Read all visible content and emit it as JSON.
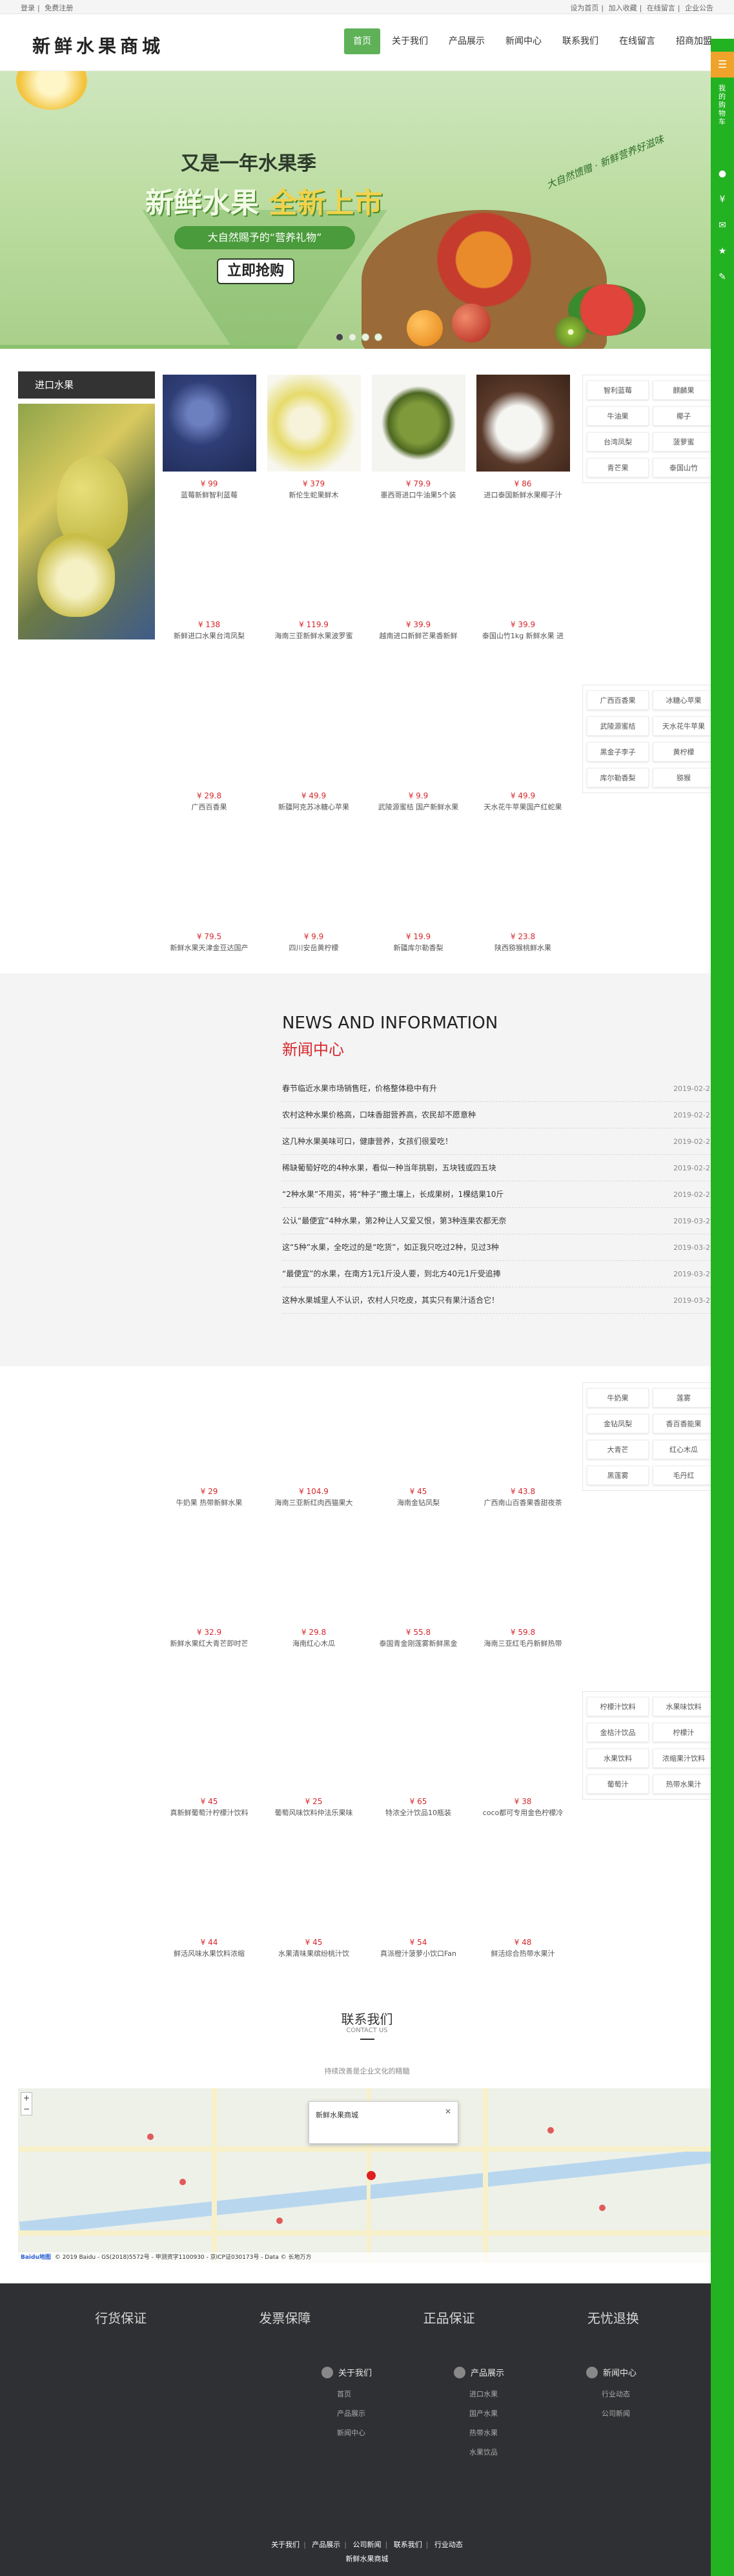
{
  "topbar": {
    "login": "登录",
    "register": "免费注册",
    "home": "设为首页",
    "favorite": "加入收藏",
    "message": "在线留言",
    "company": "企业公告"
  },
  "logo": "新鲜水果商城",
  "nav": [
    "首页",
    "关于我们",
    "产品展示",
    "新闻中心",
    "联系我们",
    "在线留言",
    "招商加盟"
  ],
  "banner": {
    "sub": "又是一年水果季",
    "title_a": "新鲜水果 ",
    "title_b": "全新上市",
    "ribbon": "大自然赐予的“营养礼物”",
    "button": "立即抢购",
    "brush": "大自然馈赠 · 新鲜营养好滋味"
  },
  "category": {
    "title": "进口水果"
  },
  "products": [
    {
      "price": "¥ 99",
      "name": "蓝莓新鲜智利蓝莓"
    },
    {
      "price": "¥ 379",
      "name": "新伦生蛇果鲜木"
    },
    {
      "price": "¥ 79.9",
      "name": "墨西哥进口牛油果5个装"
    },
    {
      "price": "¥ 86",
      "name": "进口泰国新鲜水果椰子汁"
    },
    {
      "price": "¥ 138",
      "name": "新鲜进口水果台湾凤梨"
    },
    {
      "price": "¥ 119.9",
      "name": "海南三亚新鲜水果波罗蜜"
    },
    {
      "price": "¥ 39.9",
      "name": "越南进口新鲜芒果香新鲜"
    },
    {
      "price": "¥ 39.9",
      "name": "泰国山竹1kg 新鲜水果 进"
    }
  ],
  "tags1": [
    "智利蓝莓",
    "麒麟果",
    "牛油果",
    "椰子",
    "台湾凤梨",
    "菠萝蜜",
    "青芒果",
    "泰国山竹"
  ],
  "products2": [
    {
      "price": "¥ 29.8",
      "name": "广西百香果"
    },
    {
      "price": "¥ 49.9",
      "name": "新疆阿克苏冰糖心苹果"
    },
    {
      "price": "¥ 9.9",
      "name": "武陵源蜜桔 国产新鲜水果"
    },
    {
      "price": "¥ 49.9",
      "name": "天水花牛苹果国产红蛇果"
    },
    {
      "price": "¥ 79.5",
      "name": "新鲜水果天津金豆达国产"
    },
    {
      "price": "¥ 9.9",
      "name": "四川安岳黄柠檬"
    },
    {
      "price": "¥ 19.9",
      "name": "新疆库尔勒香梨"
    },
    {
      "price": "¥ 23.8",
      "name": "陕西猕猴桃鲜水果"
    }
  ],
  "tags2": [
    "广西百香果",
    "冰糖心苹果",
    "武陵源蜜桔",
    "天水花牛苹果",
    "黑金子李子",
    "黄柠檬",
    "库尔勒香梨",
    "猕猴"
  ],
  "news": {
    "en": "NEWS AND INFORMATION",
    "cn": "新闻中心",
    "items": [
      {
        "t": "春节临近水果市场销售旺，价格整体稳中有升",
        "d": "2019-02-25"
      },
      {
        "t": "农村这种水果价格高，口味香甜营养高，农民却不愿意种",
        "d": "2019-02-25"
      },
      {
        "t": "这几种水果美味可口，健康营养，女孩们很爱吃！",
        "d": "2019-02-25"
      },
      {
        "t": "稀缺葡萄好吃的4种水果，看似一种当年挑剔，五块钱或四五块",
        "d": "2019-02-25"
      },
      {
        "t": "“2种水果”不用买，将“种子”撒土壤上，长成果树，1棵结果10斤",
        "d": "2019-02-25"
      },
      {
        "t": "公认“最便宜”4种水果，第2种让人又爱又恨，第3种连果农都无奈",
        "d": "2019-03-29"
      },
      {
        "t": "这“5种”水果，全吃过的是“吃货”，如正我只吃过2种，见过3种",
        "d": "2019-03-29"
      },
      {
        "t": "“最便宜”的水果，在南方1元1斤没人要，到北方40元1斤受追捧",
        "d": "2019-03-29"
      },
      {
        "t": "这种水果城里人不认识，农村人只吃皮，其实只有果汁适合它！",
        "d": "2019-03-29"
      }
    ]
  },
  "products3": [
    {
      "price": "¥ 29",
      "name": "牛奶果 热带新鲜水果"
    },
    {
      "price": "¥ 104.9",
      "name": "海南三亚新红肉西猫果大"
    },
    {
      "price": "¥ 45",
      "name": "海南金钻凤梨"
    },
    {
      "price": "¥ 43.8",
      "name": "广西南山百香果香甜夜茶"
    },
    {
      "price": "¥ 32.9",
      "name": "新鲜水果红大青芒即时芒"
    },
    {
      "price": "¥ 29.8",
      "name": "海南红心木瓜"
    },
    {
      "price": "¥ 55.8",
      "name": "泰国青金刚莲雾新鲜黑金"
    },
    {
      "price": "¥ 59.8",
      "name": "海南三亚红毛丹新鲜热带"
    }
  ],
  "tags3": [
    "牛奶果",
    "莲雾",
    "金钻凤梨",
    "香百香能果",
    "大青芒",
    "红心木瓜",
    "黑莲雾",
    "毛丹红"
  ],
  "products4": [
    {
      "price": "¥ 45",
      "name": "真新鲜葡萄汁柠檬汁饮料"
    },
    {
      "price": "¥ 25",
      "name": "葡萄风味饮料仲法乐果味"
    },
    {
      "price": "¥ 65",
      "name": "特浓全汁饮品10瓶装"
    },
    {
      "price": "¥ 38",
      "name": "coco都可专用金色柠檬冷"
    },
    {
      "price": "¥ 44",
      "name": "鲜活风味水果饮料浓缩"
    },
    {
      "price": "¥ 45",
      "name": "水果清味果缤纷桃汁饮"
    },
    {
      "price": "¥ 54",
      "name": "真派橙汁菠萝小饮口Fan"
    },
    {
      "price": "¥ 48",
      "name": "鲜活综合热带水果汁"
    }
  ],
  "tags4": [
    "柠檬汁饮料",
    "水果味饮料",
    "金桔汁饮品",
    "柠檬汁",
    "水果饮料",
    "浓缩果汁饮料",
    "葡萄汁",
    "热带水果汁"
  ],
  "contact": {
    "title": "联系我们",
    "sub": "CONTACT US",
    "desc": "持续改善是企业文化的精髓",
    "bubble": "新鲜水果商城",
    "copyright": "© 2019 Baidu - GS(2018)5572号 - 甲测资字1100930 - 京ICP证030173号 - Data © 长地万方",
    "baidu": "Baidu地图"
  },
  "footer": {
    "guarantees": [
      "行货保证",
      "发票保障",
      "正品保证",
      "无忧退换"
    ],
    "cols": [
      {
        "h": "关于我们",
        "items": [
          "首页",
          "产品展示",
          "新闻中心"
        ]
      },
      {
        "h": "产品展示",
        "items": [
          "进口水果",
          "国产水果",
          "热带水果",
          "水果饮品"
        ]
      },
      {
        "h": "新闻中心",
        "items": [
          "行业动态",
          "公司新闻"
        ]
      }
    ],
    "links": [
      "关于我们",
      "产品展示",
      "公司新闻",
      "联系我们",
      "行业动态"
    ],
    "copy": "新鲜水果商城"
  },
  "rightbar": {
    "label": "我的购物车"
  }
}
